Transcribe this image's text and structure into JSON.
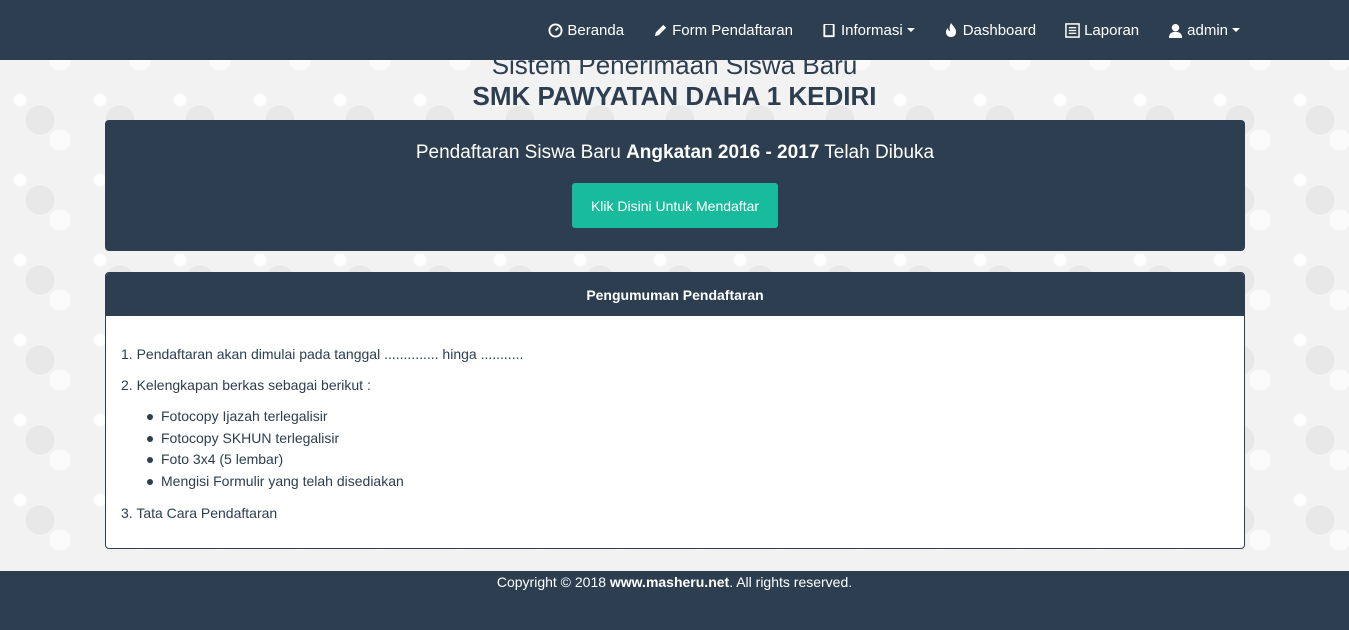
{
  "nav": {
    "items": [
      {
        "label": "Beranda",
        "icon": "dashboard-icon"
      },
      {
        "label": "Form Pendaftaran",
        "icon": "pencil-icon"
      },
      {
        "label": "Informasi",
        "icon": "book-icon"
      },
      {
        "label": "Dashboard",
        "icon": "fire-icon"
      },
      {
        "label": "Laporan",
        "icon": "list-alt-icon"
      },
      {
        "label": "admin",
        "icon": "user-icon"
      }
    ]
  },
  "header": {
    "title": "Sistem Penerimaan Siswa Baru",
    "subtitle": "SMK PAWYATAN DAHA 1 KEDIRI"
  },
  "hero": {
    "text_before": "Pendaftaran Siswa Baru ",
    "text_bold": "Angkatan 2016 - 2017",
    "text_after": " Telah Dibuka",
    "button_label": "Klik Disini Untuk Mendaftar"
  },
  "panel": {
    "heading": "Pengumuman Pendaftaran",
    "item1": "1. Pendaftaran akan dimulai pada tanggal .............. hinga ...........",
    "item2": "2. Kelengkapan berkas sebagai berikut :",
    "requirements": [
      "Fotocopy Ijazah terlegalisir",
      "Fotocopy SKHUN terlegalisir",
      "Foto 3x4 (5 lembar)",
      "Mengisi Formulir yang telah disediakan"
    ],
    "item3": "3. Tata Cara Pendaftaran"
  },
  "footer": {
    "text_before": "Copyright © 2018 ",
    "site": "www.masheru.net",
    "text_after": ". All rights reserved."
  },
  "colors": {
    "navy": "#2c3e50",
    "teal": "#18bc9c"
  }
}
